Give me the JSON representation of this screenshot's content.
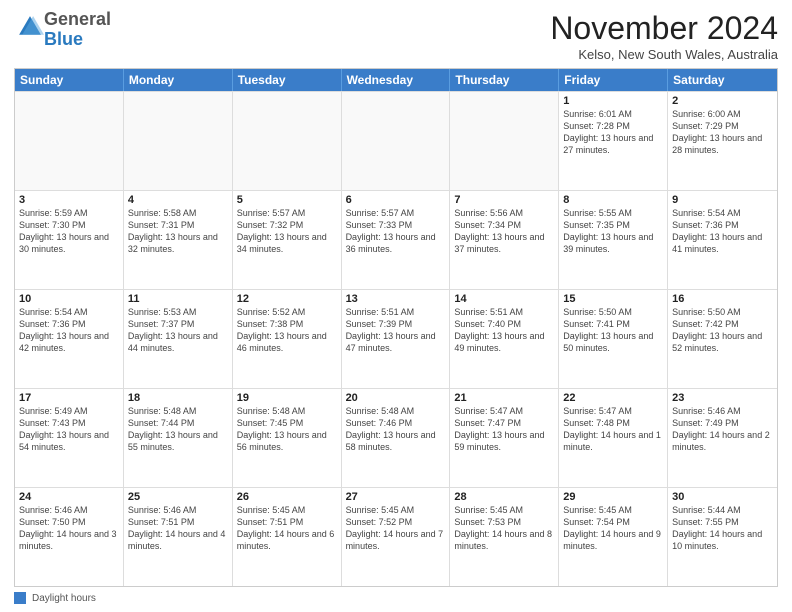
{
  "logo": {
    "general": "General",
    "blue": "Blue"
  },
  "title": "November 2024",
  "subtitle": "Kelso, New South Wales, Australia",
  "days_of_week": [
    "Sunday",
    "Monday",
    "Tuesday",
    "Wednesday",
    "Thursday",
    "Friday",
    "Saturday"
  ],
  "legend_label": "Daylight hours",
  "weeks": [
    [
      {
        "day": "",
        "empty": true
      },
      {
        "day": "",
        "empty": true
      },
      {
        "day": "",
        "empty": true
      },
      {
        "day": "",
        "empty": true
      },
      {
        "day": "",
        "empty": true
      },
      {
        "day": "1",
        "sunrise": "Sunrise: 6:01 AM",
        "sunset": "Sunset: 7:28 PM",
        "daylight": "Daylight: 13 hours and 27 minutes."
      },
      {
        "day": "2",
        "sunrise": "Sunrise: 6:00 AM",
        "sunset": "Sunset: 7:29 PM",
        "daylight": "Daylight: 13 hours and 28 minutes."
      }
    ],
    [
      {
        "day": "3",
        "sunrise": "Sunrise: 5:59 AM",
        "sunset": "Sunset: 7:30 PM",
        "daylight": "Daylight: 13 hours and 30 minutes."
      },
      {
        "day": "4",
        "sunrise": "Sunrise: 5:58 AM",
        "sunset": "Sunset: 7:31 PM",
        "daylight": "Daylight: 13 hours and 32 minutes."
      },
      {
        "day": "5",
        "sunrise": "Sunrise: 5:57 AM",
        "sunset": "Sunset: 7:32 PM",
        "daylight": "Daylight: 13 hours and 34 minutes."
      },
      {
        "day": "6",
        "sunrise": "Sunrise: 5:57 AM",
        "sunset": "Sunset: 7:33 PM",
        "daylight": "Daylight: 13 hours and 36 minutes."
      },
      {
        "day": "7",
        "sunrise": "Sunrise: 5:56 AM",
        "sunset": "Sunset: 7:34 PM",
        "daylight": "Daylight: 13 hours and 37 minutes."
      },
      {
        "day": "8",
        "sunrise": "Sunrise: 5:55 AM",
        "sunset": "Sunset: 7:35 PM",
        "daylight": "Daylight: 13 hours and 39 minutes."
      },
      {
        "day": "9",
        "sunrise": "Sunrise: 5:54 AM",
        "sunset": "Sunset: 7:36 PM",
        "daylight": "Daylight: 13 hours and 41 minutes."
      }
    ],
    [
      {
        "day": "10",
        "sunrise": "Sunrise: 5:54 AM",
        "sunset": "Sunset: 7:36 PM",
        "daylight": "Daylight: 13 hours and 42 minutes."
      },
      {
        "day": "11",
        "sunrise": "Sunrise: 5:53 AM",
        "sunset": "Sunset: 7:37 PM",
        "daylight": "Daylight: 13 hours and 44 minutes."
      },
      {
        "day": "12",
        "sunrise": "Sunrise: 5:52 AM",
        "sunset": "Sunset: 7:38 PM",
        "daylight": "Daylight: 13 hours and 46 minutes."
      },
      {
        "day": "13",
        "sunrise": "Sunrise: 5:51 AM",
        "sunset": "Sunset: 7:39 PM",
        "daylight": "Daylight: 13 hours and 47 minutes."
      },
      {
        "day": "14",
        "sunrise": "Sunrise: 5:51 AM",
        "sunset": "Sunset: 7:40 PM",
        "daylight": "Daylight: 13 hours and 49 minutes."
      },
      {
        "day": "15",
        "sunrise": "Sunrise: 5:50 AM",
        "sunset": "Sunset: 7:41 PM",
        "daylight": "Daylight: 13 hours and 50 minutes."
      },
      {
        "day": "16",
        "sunrise": "Sunrise: 5:50 AM",
        "sunset": "Sunset: 7:42 PM",
        "daylight": "Daylight: 13 hours and 52 minutes."
      }
    ],
    [
      {
        "day": "17",
        "sunrise": "Sunrise: 5:49 AM",
        "sunset": "Sunset: 7:43 PM",
        "daylight": "Daylight: 13 hours and 54 minutes."
      },
      {
        "day": "18",
        "sunrise": "Sunrise: 5:48 AM",
        "sunset": "Sunset: 7:44 PM",
        "daylight": "Daylight: 13 hours and 55 minutes."
      },
      {
        "day": "19",
        "sunrise": "Sunrise: 5:48 AM",
        "sunset": "Sunset: 7:45 PM",
        "daylight": "Daylight: 13 hours and 56 minutes."
      },
      {
        "day": "20",
        "sunrise": "Sunrise: 5:48 AM",
        "sunset": "Sunset: 7:46 PM",
        "daylight": "Daylight: 13 hours and 58 minutes."
      },
      {
        "day": "21",
        "sunrise": "Sunrise: 5:47 AM",
        "sunset": "Sunset: 7:47 PM",
        "daylight": "Daylight: 13 hours and 59 minutes."
      },
      {
        "day": "22",
        "sunrise": "Sunrise: 5:47 AM",
        "sunset": "Sunset: 7:48 PM",
        "daylight": "Daylight: 14 hours and 1 minute."
      },
      {
        "day": "23",
        "sunrise": "Sunrise: 5:46 AM",
        "sunset": "Sunset: 7:49 PM",
        "daylight": "Daylight: 14 hours and 2 minutes."
      }
    ],
    [
      {
        "day": "24",
        "sunrise": "Sunrise: 5:46 AM",
        "sunset": "Sunset: 7:50 PM",
        "daylight": "Daylight: 14 hours and 3 minutes."
      },
      {
        "day": "25",
        "sunrise": "Sunrise: 5:46 AM",
        "sunset": "Sunset: 7:51 PM",
        "daylight": "Daylight: 14 hours and 4 minutes."
      },
      {
        "day": "26",
        "sunrise": "Sunrise: 5:45 AM",
        "sunset": "Sunset: 7:51 PM",
        "daylight": "Daylight: 14 hours and 6 minutes."
      },
      {
        "day": "27",
        "sunrise": "Sunrise: 5:45 AM",
        "sunset": "Sunset: 7:52 PM",
        "daylight": "Daylight: 14 hours and 7 minutes."
      },
      {
        "day": "28",
        "sunrise": "Sunrise: 5:45 AM",
        "sunset": "Sunset: 7:53 PM",
        "daylight": "Daylight: 14 hours and 8 minutes."
      },
      {
        "day": "29",
        "sunrise": "Sunrise: 5:45 AM",
        "sunset": "Sunset: 7:54 PM",
        "daylight": "Daylight: 14 hours and 9 minutes."
      },
      {
        "day": "30",
        "sunrise": "Sunrise: 5:44 AM",
        "sunset": "Sunset: 7:55 PM",
        "daylight": "Daylight: 14 hours and 10 minutes."
      }
    ]
  ]
}
